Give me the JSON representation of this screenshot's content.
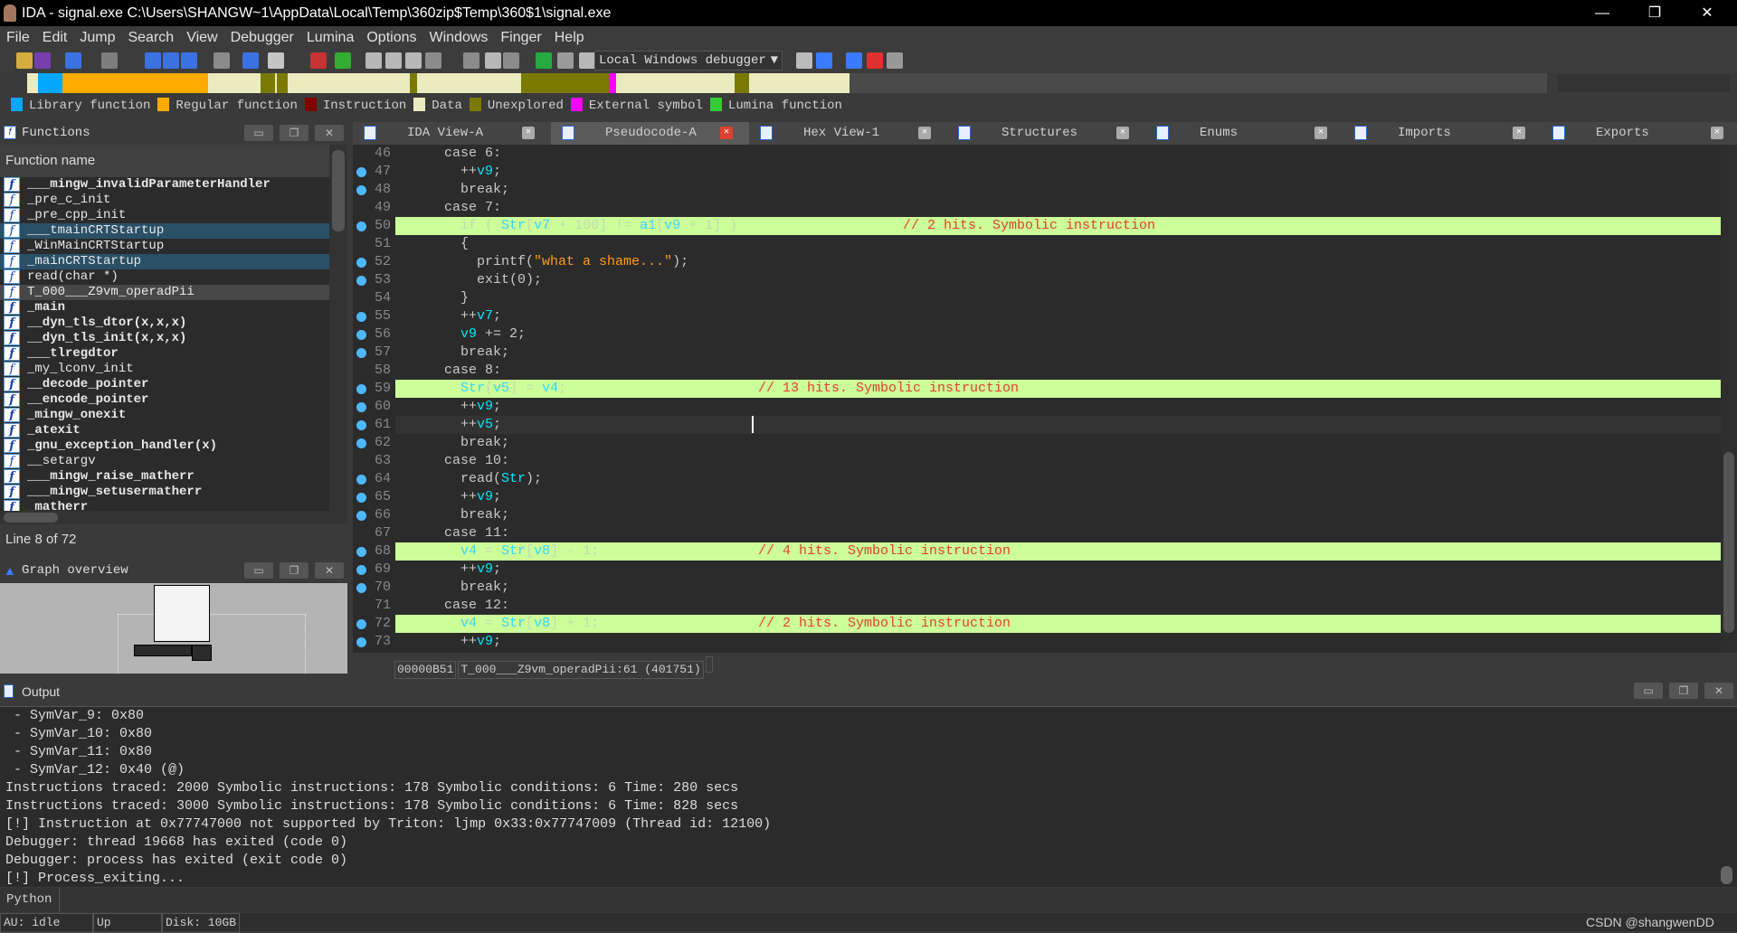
{
  "window": {
    "title": "IDA - signal.exe C:\\Users\\SHANGW~1\\AppData\\Local\\Temp\\360zip$Temp\\360$1\\signal.exe"
  },
  "menu": [
    "File",
    "Edit",
    "Jump",
    "Search",
    "View",
    "Debugger",
    "Lumina",
    "Options",
    "Windows",
    "Finger",
    "Help"
  ],
  "toolbar": {
    "debugger_select": "Local Windows debugger"
  },
  "legend": [
    {
      "label": "Library function",
      "color": "#00a8ff"
    },
    {
      "label": "Regular function",
      "color": "#ffaa00"
    },
    {
      "label": "Instruction",
      "color": "#800000"
    },
    {
      "label": "Data",
      "color": "#ebebc0"
    },
    {
      "label": "Unexplored",
      "color": "#7a7a00"
    },
    {
      "label": "External symbol",
      "color": "#ff00ff"
    },
    {
      "label": "Lumina function",
      "color": "#33cc33"
    }
  ],
  "functions": {
    "title": "Functions",
    "column": "Function name",
    "status": "Line 8 of 72",
    "items": [
      {
        "name": "___mingw_invalidParameterHandler",
        "bold": true
      },
      {
        "name": "_pre_c_init"
      },
      {
        "name": "_pre_cpp_init"
      },
      {
        "name": "___tmainCRTStartup",
        "selected": true
      },
      {
        "name": "_WinMainCRTStartup"
      },
      {
        "name": "_mainCRTStartup",
        "selected": true
      },
      {
        "name": "read(char *)"
      },
      {
        "name": "T_000___Z9vm_operadPii",
        "current": true
      },
      {
        "name": "_main",
        "bold": true
      },
      {
        "name": "__dyn_tls_dtor(x,x,x)",
        "bold": true
      },
      {
        "name": "__dyn_tls_init(x,x,x)",
        "bold": true
      },
      {
        "name": "___tlregdtor",
        "bold": true
      },
      {
        "name": "_my_lconv_init"
      },
      {
        "name": "__decode_pointer",
        "bold": true
      },
      {
        "name": "__encode_pointer",
        "bold": true
      },
      {
        "name": "_mingw_onexit",
        "bold": true
      },
      {
        "name": "_atexit",
        "bold": true
      },
      {
        "name": "_gnu_exception_handler(x)",
        "bold": true
      },
      {
        "name": "__setargv"
      },
      {
        "name": "___mingw_raise_matherr",
        "bold": true
      },
      {
        "name": "___mingw_setusermatherr",
        "bold": true
      },
      {
        "name": "_matherr",
        "bold": true
      }
    ]
  },
  "graph_overview": {
    "title": "Graph overview"
  },
  "tabs": [
    {
      "label": "IDA View-A"
    },
    {
      "label": "Pseudocode-A",
      "active": true
    },
    {
      "label": "Hex View-1"
    },
    {
      "label": "Structures"
    },
    {
      "label": "Enums"
    },
    {
      "label": "Imports"
    },
    {
      "label": "Exports"
    }
  ],
  "code": [
    {
      "n": 46,
      "i": 6,
      "t": [
        [
          "case 6:",
          "k"
        ]
      ]
    },
    {
      "n": 47,
      "bp": true,
      "i": 8,
      "t": [
        [
          "++",
          "k"
        ],
        [
          "v9",
          "v"
        ],
        [
          ";",
          "k"
        ]
      ]
    },
    {
      "n": 48,
      "bp": true,
      "i": 8,
      "t": [
        [
          "break;",
          "k"
        ]
      ]
    },
    {
      "n": 49,
      "i": 6,
      "t": [
        [
          "case 7:",
          "k"
        ]
      ]
    },
    {
      "n": 50,
      "bp": true,
      "hl": true,
      "i": 8,
      "t": [
        [
          "if ( ",
          "k"
        ],
        [
          "Str",
          "v"
        ],
        [
          "[",
          "k"
        ],
        [
          "v7",
          "v"
        ],
        [
          " + 100] != ",
          "k"
        ],
        [
          "a1",
          "v"
        ],
        [
          "[",
          "k"
        ],
        [
          "v9",
          "v"
        ],
        [
          " + 1] )",
          "k"
        ]
      ],
      "comment": "// 2 hits. Symbolic instruction"
    },
    {
      "n": 51,
      "i": 8,
      "t": [
        [
          "{",
          "k"
        ]
      ]
    },
    {
      "n": 52,
      "bp": true,
      "i": 10,
      "t": [
        [
          "printf(",
          "k"
        ],
        [
          "\"what a shame...\"",
          "s"
        ],
        [
          ");",
          "k"
        ]
      ]
    },
    {
      "n": 53,
      "bp": true,
      "i": 10,
      "t": [
        [
          "exit(0);",
          "k"
        ]
      ]
    },
    {
      "n": 54,
      "i": 8,
      "t": [
        [
          "}",
          "k"
        ]
      ]
    },
    {
      "n": 55,
      "bp": true,
      "i": 8,
      "t": [
        [
          "++",
          "k"
        ],
        [
          "v7",
          "v"
        ],
        [
          ";",
          "k"
        ]
      ]
    },
    {
      "n": 56,
      "bp": true,
      "i": 8,
      "t": [
        [
          "v9",
          "v"
        ],
        [
          " += 2;",
          "k"
        ]
      ]
    },
    {
      "n": 57,
      "bp": true,
      "i": 8,
      "t": [
        [
          "break;",
          "k"
        ]
      ]
    },
    {
      "n": 58,
      "i": 6,
      "t": [
        [
          "case 8:",
          "k"
        ]
      ]
    },
    {
      "n": 59,
      "bp": true,
      "hl": true,
      "i": 8,
      "t": [
        [
          "Str",
          "v"
        ],
        [
          "[",
          "k"
        ],
        [
          "v5",
          "v"
        ],
        [
          "] = ",
          "k"
        ],
        [
          "v4",
          "v"
        ],
        [
          ";",
          "k"
        ]
      ],
      "comment": "// 13 hits. Symbolic instruction"
    },
    {
      "n": 60,
      "bp": true,
      "i": 8,
      "t": [
        [
          "++",
          "k"
        ],
        [
          "v9",
          "v"
        ],
        [
          ";",
          "k"
        ]
      ]
    },
    {
      "n": 61,
      "bp": true,
      "cur": true,
      "i": 8,
      "t": [
        [
          "++",
          "k"
        ],
        [
          "v5",
          "v"
        ],
        [
          ";",
          "k"
        ]
      ]
    },
    {
      "n": 62,
      "bp": true,
      "i": 8,
      "t": [
        [
          "break;",
          "k"
        ]
      ]
    },
    {
      "n": 63,
      "i": 6,
      "t": [
        [
          "case 10:",
          "k"
        ]
      ]
    },
    {
      "n": 64,
      "bp": true,
      "i": 8,
      "t": [
        [
          "read(",
          "k"
        ],
        [
          "Str",
          "v"
        ],
        [
          ");",
          "k"
        ]
      ]
    },
    {
      "n": 65,
      "bp": true,
      "i": 8,
      "t": [
        [
          "++",
          "k"
        ],
        [
          "v9",
          "v"
        ],
        [
          ";",
          "k"
        ]
      ]
    },
    {
      "n": 66,
      "bp": true,
      "i": 8,
      "t": [
        [
          "break;",
          "k"
        ]
      ]
    },
    {
      "n": 67,
      "i": 6,
      "t": [
        [
          "case 11:",
          "k"
        ]
      ]
    },
    {
      "n": 68,
      "bp": true,
      "hl": true,
      "i": 8,
      "t": [
        [
          "v4",
          "v"
        ],
        [
          " = ",
          "k"
        ],
        [
          "Str",
          "v"
        ],
        [
          "[",
          "k"
        ],
        [
          "v8",
          "v"
        ],
        [
          "] - 1;",
          "k"
        ]
      ],
      "comment": "// 4 hits. Symbolic instruction"
    },
    {
      "n": 69,
      "bp": true,
      "i": 8,
      "t": [
        [
          "++",
          "k"
        ],
        [
          "v9",
          "v"
        ],
        [
          ";",
          "k"
        ]
      ]
    },
    {
      "n": 70,
      "bp": true,
      "i": 8,
      "t": [
        [
          "break;",
          "k"
        ]
      ]
    },
    {
      "n": 71,
      "i": 6,
      "t": [
        [
          "case 12:",
          "k"
        ]
      ]
    },
    {
      "n": 72,
      "bp": true,
      "hl": true,
      "i": 8,
      "t": [
        [
          "v4",
          "v"
        ],
        [
          " = ",
          "k"
        ],
        [
          "Str",
          "v"
        ],
        [
          "[",
          "k"
        ],
        [
          "v8",
          "v"
        ],
        [
          "] + 1;",
          "k"
        ]
      ],
      "comment": "// 2 hits. Symbolic instruction"
    },
    {
      "n": 73,
      "bp": true,
      "i": 8,
      "t": [
        [
          "++",
          "k"
        ],
        [
          "v9",
          "v"
        ],
        [
          ";",
          "k"
        ]
      ]
    }
  ],
  "code_status": {
    "offset": "00000B51",
    "location": "T_000___Z9vm_operadPii:61 (401751)"
  },
  "output": {
    "title": "Output",
    "lines": [
      " - SymVar_9: 0x80",
      " - SymVar_10: 0x80",
      " - SymVar_11: 0x80",
      " - SymVar_12: 0x40 (@)",
      "Instructions traced: 2000 Symbolic instructions: 178 Symbolic conditions: 6 Time: 280 secs",
      "Instructions traced: 3000 Symbolic instructions: 178 Symbolic conditions: 6 Time: 828 secs",
      "[!] Instruction at 0x77747000 not supported by Triton: ljmp 0x33:0x77747009 (Thread id: 12100)",
      "Debugger: thread 19668 has exited (code 0)",
      "Debugger: process has exited (exit code 0)",
      "[!] Process_exiting..."
    ]
  },
  "python": {
    "label": "Python"
  },
  "statusbar": {
    "au": "AU:  idle",
    "state": "Up",
    "disk": "Disk: 10GB"
  },
  "watermark": "CSDN @shangwenDD"
}
